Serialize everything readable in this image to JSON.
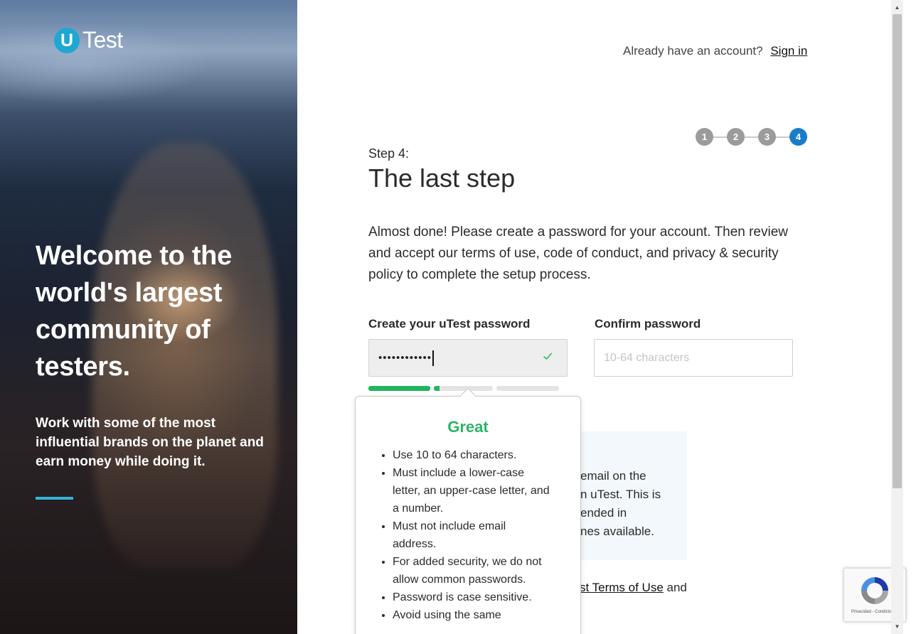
{
  "brand": {
    "logo_letter": "U",
    "logo_name": "Test"
  },
  "hero": {
    "headline": "Welcome to the world's largest community of testers.",
    "subtext": "Work with some of the most influential brands on the planet and earn money while doing it."
  },
  "header": {
    "prompt": "Already have an account?",
    "signin_label": "Sign in"
  },
  "steps": {
    "items": [
      "1",
      "2",
      "3",
      "4"
    ],
    "active": 4
  },
  "form": {
    "step_label": "Step 4:",
    "title": "The last step",
    "intro": "Almost done! Please create a password for your account. Then review and accept our terms of use, code of conduct, and privacy & security policy to complete the setup process.",
    "password": {
      "label": "Create your uTest password",
      "value": "••••••••••••",
      "valid_icon": "check-icon"
    },
    "confirm": {
      "label": "Confirm password",
      "placeholder": "10-64 characters"
    },
    "strength": {
      "segments": [
        1.0,
        0.1,
        0.0
      ],
      "color": "#24b45f"
    }
  },
  "info_box": {
    "lines": [
      "email on the",
      "n uTest. This is",
      "ended in",
      "nes available."
    ]
  },
  "terms": {
    "prefix": "",
    "link": "st Terms of Use",
    "suffix": " and"
  },
  "tooltip": {
    "title": "Great",
    "rules": [
      "Use 10 to 64 characters.",
      "Must include a lower-case letter, an upper-case letter, and a number.",
      "Must not include email address.",
      "For added security, we do not allow common passwords.",
      "Password is case sensitive.",
      "Avoid using the same"
    ]
  },
  "recaptcha": {
    "caption": "Privacidad - Condiciones"
  },
  "colors": {
    "accent": "#1a7ec7",
    "success": "#2bb567",
    "logo": "#1ea7d0"
  }
}
